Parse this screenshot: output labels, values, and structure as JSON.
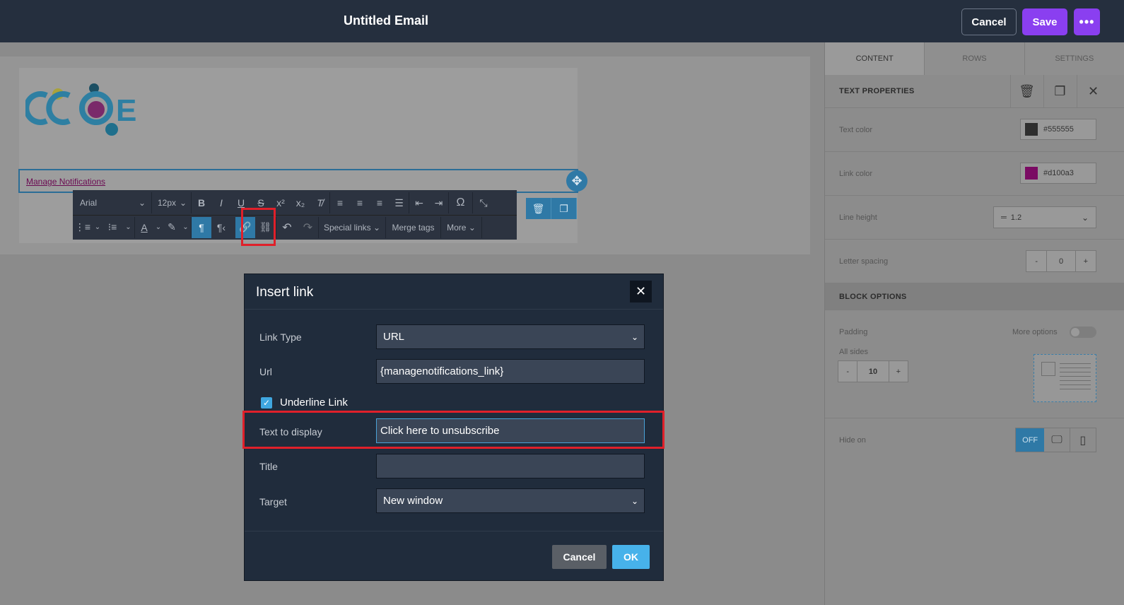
{
  "topbar": {
    "title": "Untitled Email",
    "cancel_label": "Cancel",
    "save_label": "Save",
    "more_label": "•••"
  },
  "canvas": {
    "logo_text": "CCOE",
    "link_text": "Manage Notifications"
  },
  "toolbar": {
    "font": "Arial",
    "size": "12px",
    "special_links": "Special links",
    "merge_tags": "Merge tags",
    "more": "More"
  },
  "panel": {
    "tabs": [
      "CONTENT",
      "ROWS",
      "SETTINGS"
    ],
    "text_properties": "TEXT PROPERTIES",
    "text_color_label": "Text color",
    "text_color_value": "#555555",
    "link_color_label": "Link color",
    "link_color_value": "#d100a3",
    "line_height_label": "Line height",
    "line_height_value": "1.2",
    "letter_spacing_label": "Letter spacing",
    "letter_spacing_value": "0",
    "block_options": "BLOCK OPTIONS",
    "padding_label": "Padding",
    "more_options_label": "More options",
    "all_sides_label": "All sides",
    "padding_value": "10",
    "hide_on_label": "Hide on",
    "hide_off": "OFF",
    "minus": "-",
    "plus": "+"
  },
  "modal": {
    "title": "Insert link",
    "link_type_label": "Link Type",
    "link_type_value": "URL",
    "url_label": "Url",
    "url_value": "{managenotifications_link}",
    "underline_label": "Underline Link",
    "text_display_label": "Text to display",
    "text_display_value": "Click here to unsubscribe",
    "title_label": "Title",
    "title_value": "",
    "target_label": "Target",
    "target_value": "New window",
    "cancel_label": "Cancel",
    "ok_label": "OK"
  },
  "colors": {
    "accent": "#8a3ff0",
    "link_color": "#d100a3",
    "text_color": "#555555",
    "highlight": "#e0202a",
    "ok_button": "#47b2ea"
  }
}
